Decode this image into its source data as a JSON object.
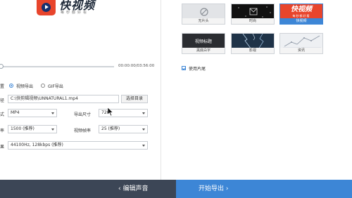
{
  "logo": {
    "text": "快视频",
    "slogan": "每秒都好看"
  },
  "player": {
    "time": "00:00:00/03:56:00",
    "progress": 0.01
  },
  "export_mode": {
    "label": "置",
    "options": [
      "视频导出",
      "GIF导出"
    ],
    "selected": "视频导出"
  },
  "path": {
    "label": "径",
    "value": "C:\\快剪辑视频\\UNNATURAL1.mp4",
    "browse_label": "选择目录"
  },
  "format": {
    "label": "式",
    "value": "MP4"
  },
  "export_size": {
    "label": "导出尺寸",
    "value": "720"
  },
  "bitrate": {
    "label": "率",
    "value": "1500 (推荐)"
  },
  "frame_rate": {
    "label": "视频帧率",
    "value": "25 (推荐)"
  },
  "audio": {
    "label": "果",
    "value": "44100Hz, 128kbps (推荐)"
  },
  "thumbnails": [
    {
      "caption": "无片头",
      "picture": "none-icon"
    },
    {
      "caption": "时尚",
      "picture": "film-icon"
    },
    {
      "caption": "快视频",
      "picture": "快视频",
      "subtext": "每秒都好看",
      "selected": true
    },
    {
      "caption": "黑底白字",
      "picture": "视频标题"
    },
    {
      "caption": "影视",
      "picture": "lightning-icon"
    },
    {
      "caption": "资讯",
      "picture": "chart-icon"
    }
  ],
  "use_outro": {
    "label": "使用片尾",
    "checked": true
  },
  "footer": {
    "edit_audio": "编辑声音",
    "start_export": "开始导出"
  },
  "colors": {
    "accent": "#3d86d6",
    "footer_dark": "#3c4656",
    "logo_red": "#e8452c"
  }
}
